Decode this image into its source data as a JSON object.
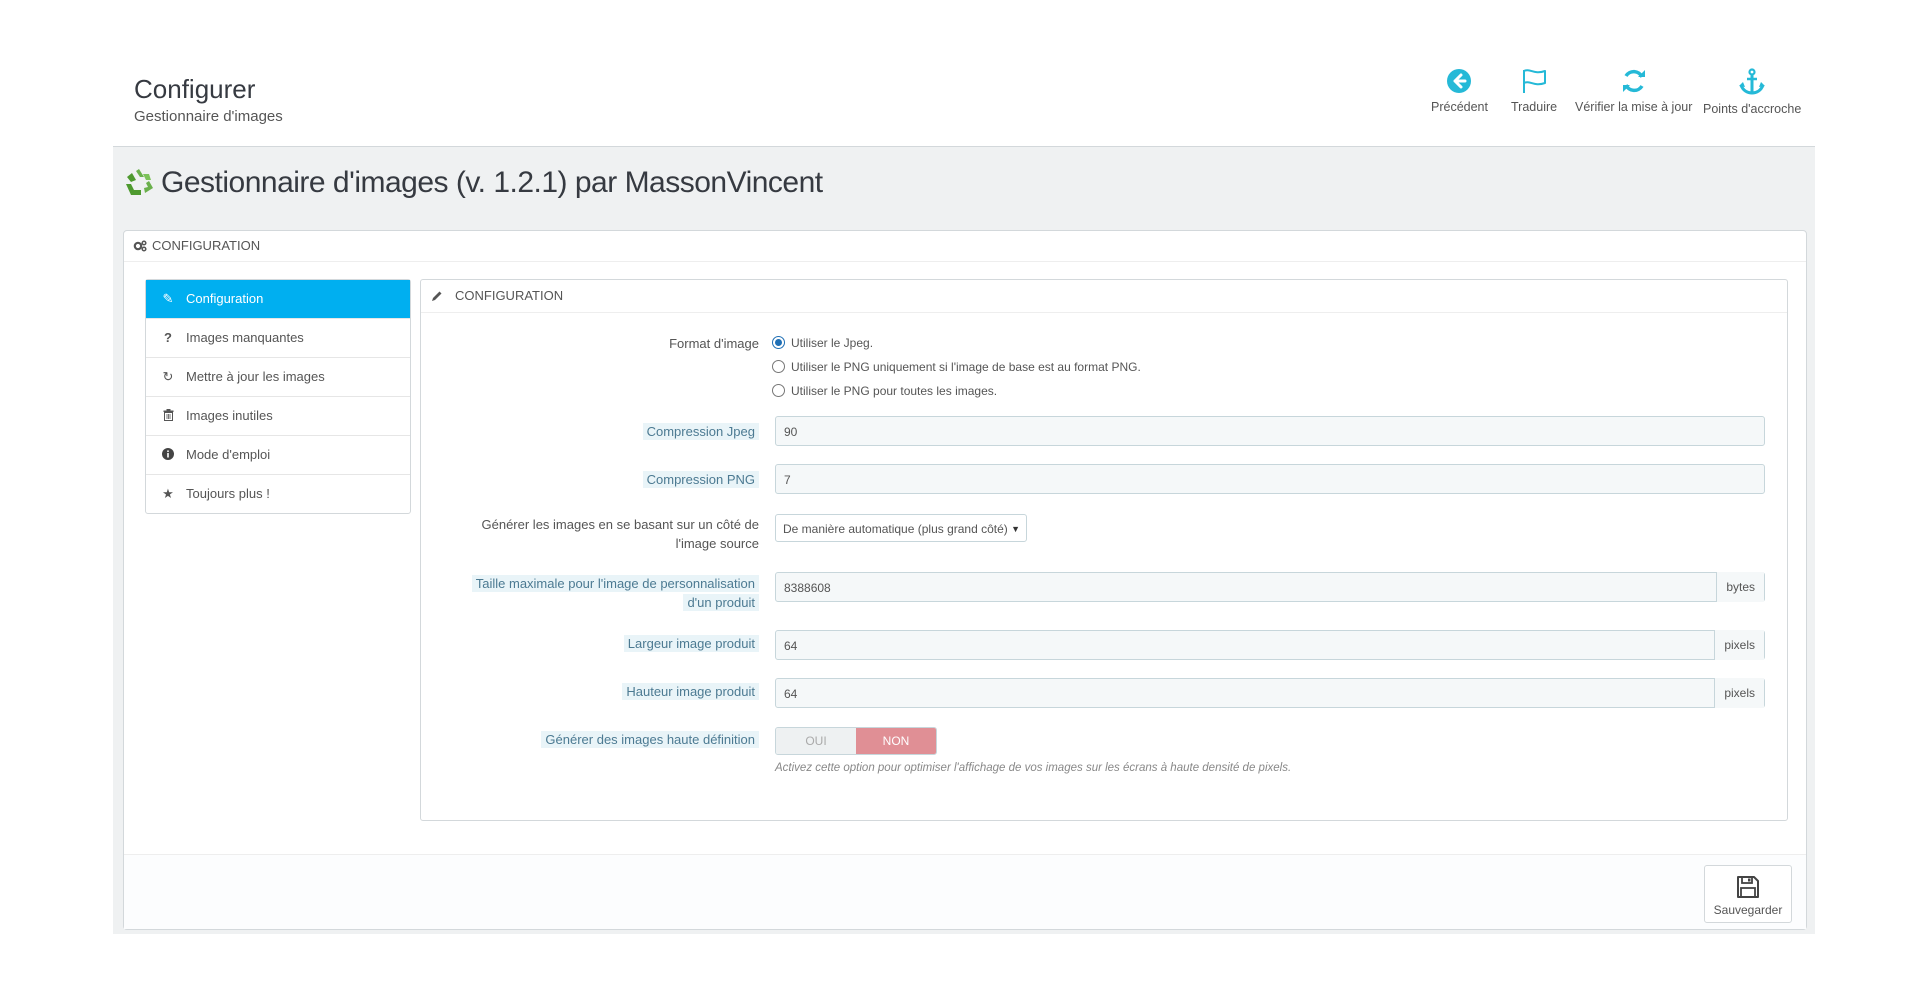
{
  "toolbar": {
    "title": "Configurer",
    "subtitle": "Gestionnaire d'images",
    "buttons": [
      {
        "label": "Précédent",
        "icon": "arrow-circle-left-icon"
      },
      {
        "label": "Traduire",
        "icon": "flag-icon"
      },
      {
        "label": "Vérifier la mise à jour",
        "icon": "refresh-icon"
      },
      {
        "label": "Points d'accroche",
        "icon": "anchor-icon"
      }
    ]
  },
  "module": {
    "title": "Gestionnaire d'images (v. 1.2.1) par MassonVincent"
  },
  "panel": {
    "heading": "CONFIGURATION"
  },
  "sidenav": {
    "items": [
      {
        "label": "Configuration",
        "icon": "pencil-icon",
        "active": true
      },
      {
        "label": "Images manquantes",
        "icon": "question-icon"
      },
      {
        "label": "Mettre à jour les images",
        "icon": "refresh-icon"
      },
      {
        "label": "Images inutiles",
        "icon": "trash-icon"
      },
      {
        "label": "Mode d'emploi",
        "icon": "info-icon"
      },
      {
        "label": "Toujours plus !",
        "icon": "star-icon"
      }
    ]
  },
  "form": {
    "heading": "CONFIGURATION",
    "image_format": {
      "label": "Format d'image",
      "options": [
        {
          "label": "Utiliser le Jpeg.",
          "checked": true
        },
        {
          "label": "Utiliser le PNG uniquement si l'image de base est au format PNG.",
          "checked": false
        },
        {
          "label": "Utiliser le PNG pour toutes les images.",
          "checked": false
        }
      ]
    },
    "jpeg_compression": {
      "label": "Compression Jpeg",
      "value": "90"
    },
    "png_compression": {
      "label": "Compression PNG",
      "value": "7"
    },
    "generate_side": {
      "label_line1": "Générer les images en se basant sur un côté de",
      "label_line2": "l'image source",
      "value": "De manière automatique (plus grand côté)"
    },
    "max_custom_size": {
      "label_line1": "Taille maximale pour l'image de personnalisation",
      "label_line2": "d'un produit",
      "value": "8388608",
      "unit": "bytes"
    },
    "product_width": {
      "label": "Largeur image produit",
      "value": "64",
      "unit": "pixels"
    },
    "product_height": {
      "label": "Hauteur image produit",
      "value": "64",
      "unit": "pixels"
    },
    "hd_images": {
      "label": "Générer des images haute définition",
      "yes": "OUI",
      "no": "NON",
      "selected": "NON",
      "help": "Activez cette option pour optimiser l'affichage de vos images sur les écrans à haute densité de pixels."
    }
  },
  "footer": {
    "save_label": "Sauvegarder"
  },
  "colors": {
    "accent": "#00aff0",
    "toolbar_icon": "#25b9d7",
    "switch_off": "#e08f95",
    "label_highlight": "#e9f4f8"
  }
}
